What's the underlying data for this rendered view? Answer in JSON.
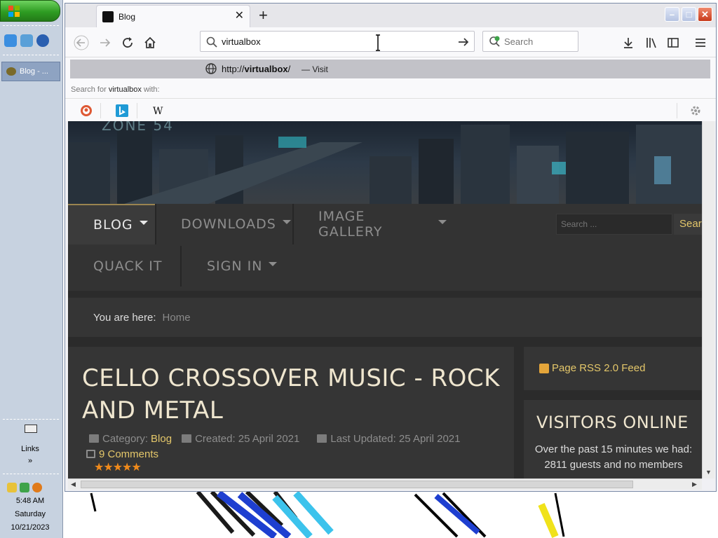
{
  "browser": {
    "tab": {
      "title": "Blog"
    },
    "url": "virtualbox",
    "search_placeholder": "Search",
    "dropdown": {
      "suggest_protocol": "http://",
      "suggest_host": "virtualbox",
      "suggest_path": "/",
      "suggest_action": "— Visit",
      "search_for_prefix": "Search for",
      "search_for_query": "virtualbox",
      "search_for_suffix": "with:",
      "engines": [
        "duckduckgo-icon",
        "bing-icon",
        "wikipedia-icon"
      ]
    }
  },
  "site": {
    "banner_label": "ZONE 54",
    "menu": [
      {
        "label": "BLOG",
        "dropdown": true,
        "active": true
      },
      {
        "label": "DOWNLOADS",
        "dropdown": true
      },
      {
        "label": "IMAGE GALLERY",
        "dropdown": true
      },
      {
        "label": "QUACK IT",
        "dropdown": false
      },
      {
        "label": "SIGN IN",
        "dropdown": true
      }
    ],
    "search_placeholder": "Search ...",
    "search_button": "Search",
    "breadcrumb": {
      "label": "You are here:",
      "home": "Home"
    },
    "article": {
      "title": "CELLO CROSSOVER MUSIC - ROCK AND METAL",
      "category_label": "Category:",
      "category": "Blog",
      "created": "Created: 25 April 2021",
      "updated": "Last Updated: 25 April 2021",
      "comments": "9 Comments",
      "rating_stars": 5
    },
    "sidebar": {
      "rss": "Page RSS 2.0 Feed",
      "visitors_title": "VISITORS ONLINE",
      "visitors_text": "Over the past 15 minutes we had: 2811 guests and no members"
    }
  },
  "taskbar": {
    "task_label": "Blog - ...",
    "links_label": "Links",
    "links_chevron": "»",
    "clock": "5:48 AM",
    "day": "Saturday",
    "date": "10/21/2023"
  },
  "colors": {
    "accent_gold": "#e4c76a",
    "star_orange": "#f08a1b",
    "page_bg": "#2b2b2b"
  }
}
